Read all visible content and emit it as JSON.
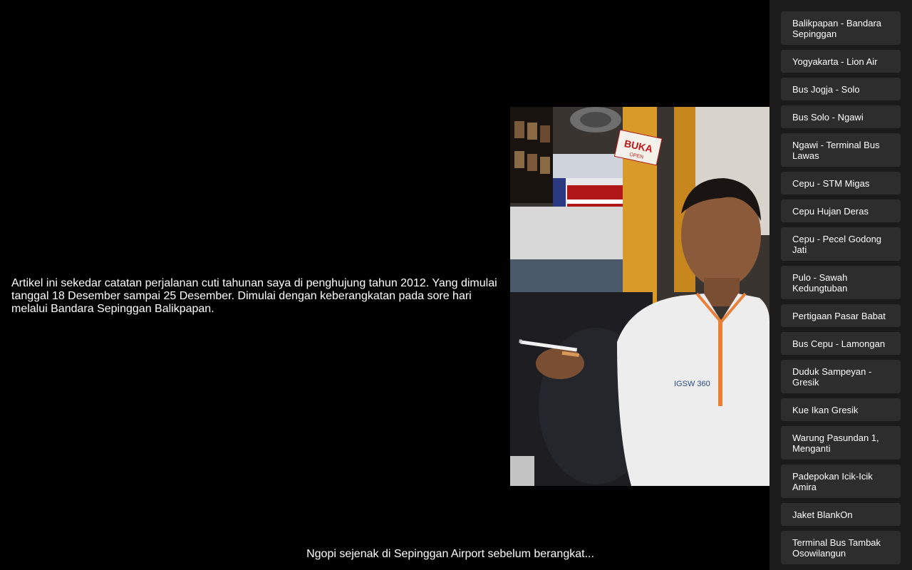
{
  "article": {
    "intro": "Artikel ini sekedar catatan perjalanan cuti tahunan saya di penghujung tahun 2012. Yang dimulai tanggal 18 Desember sampai 25 Desember. Dimulai dengan keberangkatan pada sore hari melalui Bandara Sepinggan Balikpapan.",
    "photo_caption": "Ngopi sejenak di Sepinggan Airport sebelum berangkat...",
    "photo_sign": {
      "line1": "BUKA",
      "line2": "OPEN"
    },
    "photo_shirt_text": "IGSW 360"
  },
  "sidebar": {
    "items": [
      {
        "label": "Balikpapan - Bandara Sepinggan"
      },
      {
        "label": "Yogyakarta - Lion Air"
      },
      {
        "label": "Bus Jogja - Solo"
      },
      {
        "label": "Bus Solo - Ngawi"
      },
      {
        "label": "Ngawi - Terminal Bus Lawas"
      },
      {
        "label": "Cepu - STM Migas"
      },
      {
        "label": "Cepu Hujan Deras"
      },
      {
        "label": "Cepu - Pecel Godong Jati"
      },
      {
        "label": "Pulo - Sawah Kedungtuban"
      },
      {
        "label": "Pertigaan Pasar Babat"
      },
      {
        "label": "Bus Cepu - Lamongan"
      },
      {
        "label": "Duduk Sampeyan - Gresik"
      },
      {
        "label": "Kue Ikan Gresik"
      },
      {
        "label": "Warung Pasundan 1, Menganti"
      },
      {
        "label": "Padepokan Icik-Icik Amira"
      },
      {
        "label": "Jaket BlankOn"
      },
      {
        "label": "Terminal Bus Tambak Osowilangun"
      }
    ]
  },
  "colors": {
    "background": "#000000",
    "sidebar_bg": "#1b1b1b",
    "item_bg": "#2d2d2d",
    "text": "#ffffff"
  }
}
